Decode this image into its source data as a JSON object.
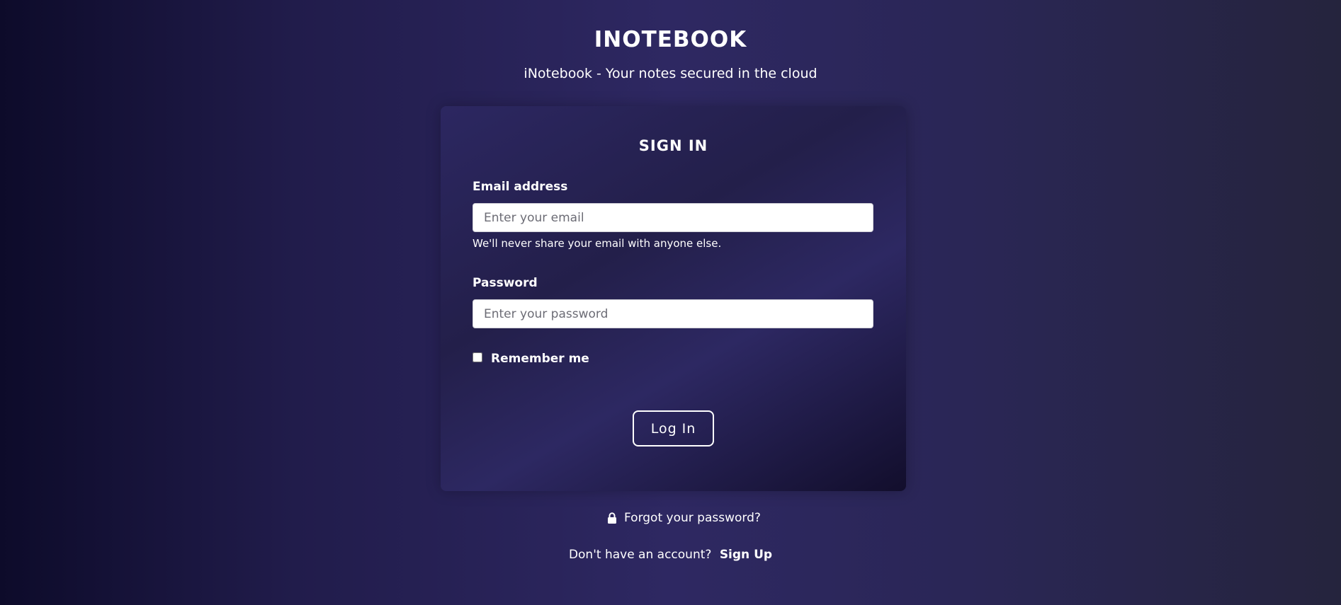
{
  "app": {
    "title": "INOTEBOOK",
    "subtitle": "iNotebook - Your notes secured in the cloud"
  },
  "login_card": {
    "title": "SIGN IN",
    "email": {
      "label": "Email address",
      "placeholder": "Enter your email",
      "value": "",
      "help": "We'll never share your email with anyone else."
    },
    "password": {
      "label": "Password",
      "placeholder": "Enter your password",
      "value": ""
    },
    "remember": {
      "label": "Remember me",
      "checked": false
    },
    "submit_label": "Log In"
  },
  "footer": {
    "forgot_label": "Forgot your password?",
    "forgot_icon": "lock-icon",
    "signup_prompt": "Don't have an account?",
    "signup_label": "Sign Up"
  },
  "colors": {
    "background_dark": "#0d0b2a",
    "background_mid": "#2e2862",
    "card_background": "#2c2761",
    "text": "#ffffff",
    "input_background": "#ffffff"
  }
}
